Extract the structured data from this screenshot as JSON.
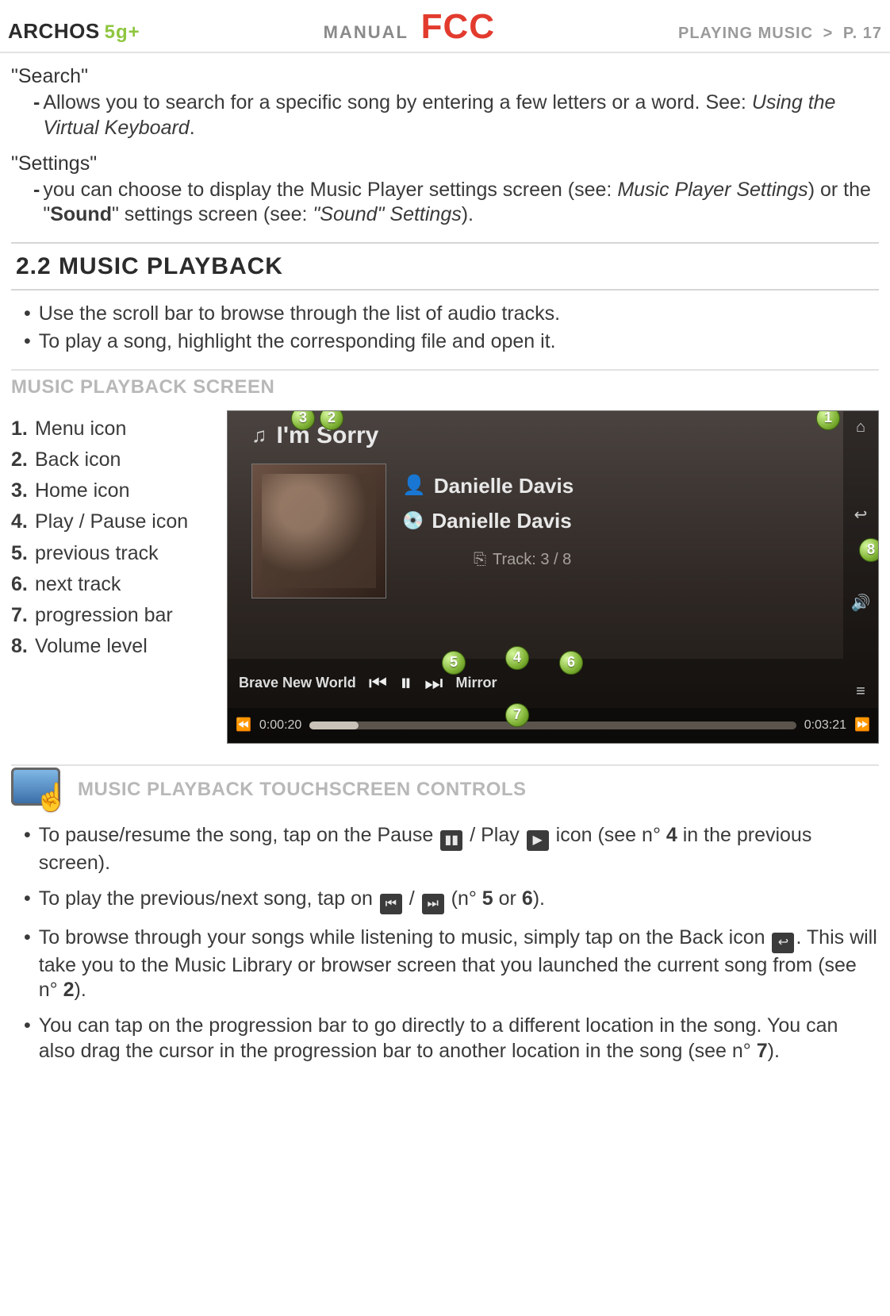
{
  "header": {
    "brand": "ARCHOS",
    "model": "5g+",
    "manual": "MANUAL",
    "fcc": "FCC",
    "section": "PLAYING MUSIC",
    "separator": ">",
    "page": "P. 17"
  },
  "search": {
    "term": "\"Search\"",
    "item_pre": "Allows you to search for a specific song by entering a few letters or a word. See: ",
    "item_italic": "Using the Virtual Keyboard",
    "item_post": "."
  },
  "settings": {
    "term": "\"Settings\"",
    "pre": "you can choose to display the Music Player settings screen (see: ",
    "it1": "Music Player Settings",
    "mid1": ") or the \"",
    "bold": "Sound",
    "mid2": "\" settings screen (see: ",
    "it2": "\"Sound\" Settings",
    "post": ")."
  },
  "section22": {
    "title": "2.2 MUSIC PLAYBACK",
    "b1": "Use the scroll bar to browse through the list of audio tracks.",
    "b2": "To play a song, highlight the corresponding file and open it."
  },
  "playback_screen": {
    "heading": "MUSIC PLAYBACK SCREEN",
    "legend": [
      "Menu icon",
      "Back icon",
      "Home icon",
      "Play / Pause icon",
      "previous track",
      "next track",
      "progression bar",
      "Volume level"
    ],
    "shot": {
      "title": "I'm Sorry",
      "artist": "Danielle Davis",
      "album": "Danielle Davis",
      "trackcount": "Track: 3 / 8",
      "prev_label": "Brave New World",
      "next_label": "Mirror",
      "time_elapsed": "0:00:20",
      "time_total": "0:03:21"
    }
  },
  "touchscreen": {
    "heading": "MUSIC PLAYBACK TOUCHSCREEN CONTROLS",
    "b1_pre": "To pause/resume the song, tap on the Pause ",
    "b1_mid": " / Play ",
    "b1_post1": " icon (see n° ",
    "b1_num": "4",
    "b1_post2": " in the previous screen).",
    "b2_pre": "To play the previous/next song, tap on ",
    "b2_mid": " / ",
    "b2_post1": " (n° ",
    "b2_n1": "5",
    "b2_or": " or ",
    "b2_n2": "6",
    "b2_post2": ").",
    "b3_pre": "To browse through your songs while listening to music, simply tap on the Back icon ",
    "b3_post1": ". This will take you to the Music Library or browser screen that you launched the current song from (see n° ",
    "b3_num": "2",
    "b3_post2": ").",
    "b4_pre": "You can tap on the progression bar to go directly to a different location in the song. You can also drag the cursor in the progression bar to another location in the song (see n° ",
    "b4_num": "7",
    "b4_post": ")."
  }
}
